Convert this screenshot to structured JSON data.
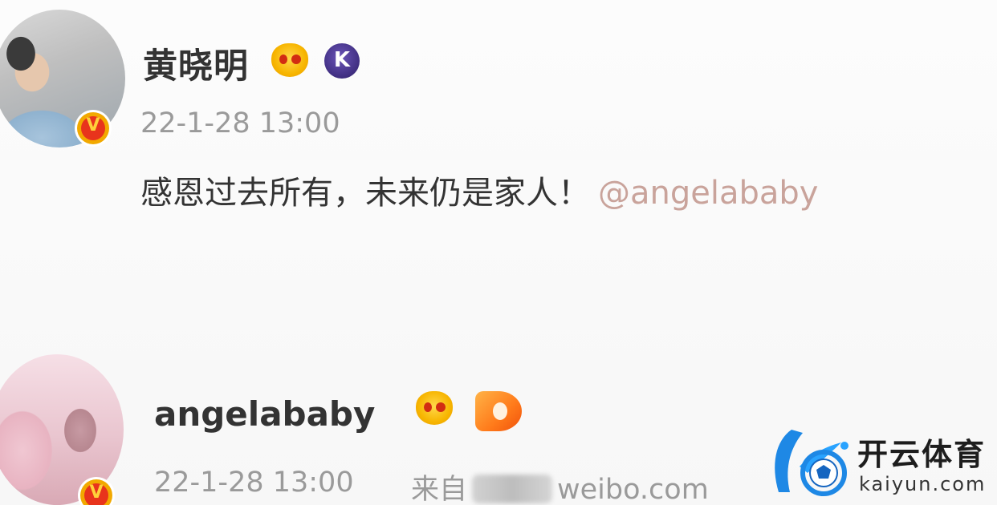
{
  "post1": {
    "username": "黄晓明",
    "timestamp": "22-1-28 13:00",
    "body": "感恩过去所有，未来仍是家人！",
    "mention": "@angelababy",
    "level_badge_letter": "K",
    "verified_badge_letter": "V"
  },
  "post2": {
    "username": "angelababy",
    "timestamp": "22-1-28 13:00",
    "source_prefix": "来自",
    "source_suffix": "weibo.com",
    "verified_badge_letter": "V"
  },
  "watermark": {
    "name": "开云体育",
    "domain": "kaiyun.com"
  },
  "colors": {
    "username": "#333333",
    "meta_gray": "#9a9a9a",
    "mention": "#c9a39b",
    "verified_red": "#e8341c",
    "verified_gold": "#f2a900",
    "watermark_blue": "#1e88e5"
  }
}
